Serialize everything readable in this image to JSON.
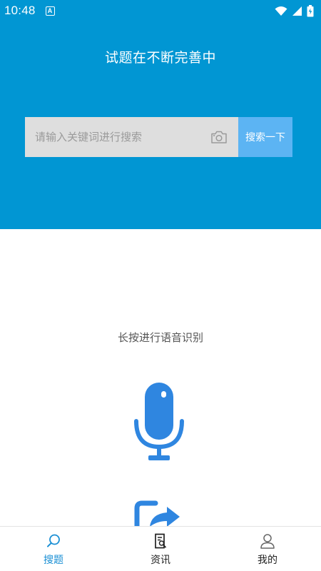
{
  "status_bar": {
    "time": "10:48",
    "notification_icon": "a-icon",
    "icons": [
      "wifi-icon",
      "signal-icon",
      "battery-icon"
    ]
  },
  "hero": {
    "title": "试题在不断完善中",
    "background": "#0196d3"
  },
  "search": {
    "placeholder": "请输入关键词进行搜索",
    "value": "",
    "camera_icon": "camera-icon",
    "button_label": "搜索一下",
    "button_color": "#5cb4f3"
  },
  "voice": {
    "hint": "长按进行语音识别",
    "mic_icon": "microphone-icon",
    "mic_color": "#2f86e0"
  },
  "bottom_nav": {
    "items": [
      {
        "label": "搜题",
        "icon": "search-icon",
        "active": true
      },
      {
        "label": "资讯",
        "icon": "news-icon",
        "active": false
      },
      {
        "label": "我的",
        "icon": "person-icon",
        "active": false
      }
    ],
    "active_color": "#1a8fd4"
  }
}
